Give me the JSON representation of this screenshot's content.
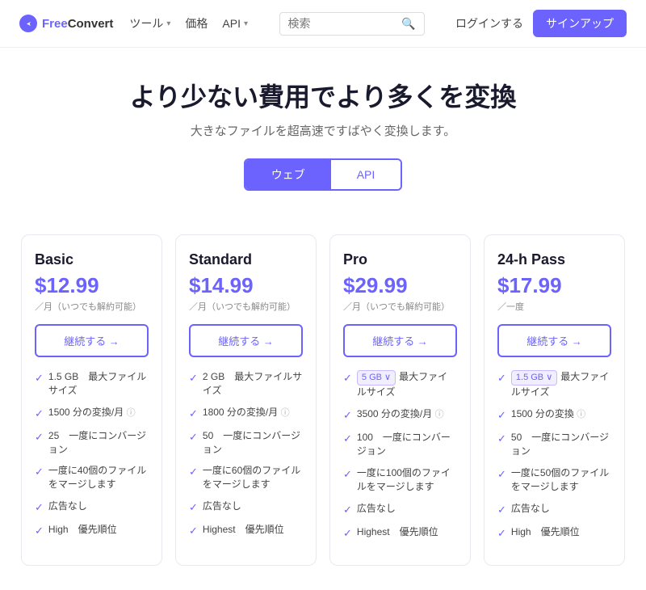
{
  "header": {
    "logo_free": "Free",
    "logo_convert": "Convert",
    "nav": [
      {
        "label": "ツール",
        "has_arrow": true
      },
      {
        "label": "価格",
        "has_arrow": false
      },
      {
        "label": "API",
        "has_arrow": true
      }
    ],
    "search_placeholder": "検索",
    "login_label": "ログインする",
    "signup_label": "サインアップ"
  },
  "hero": {
    "title": "より少ない費用でより多くを変換",
    "subtitle": "大きなファイルを超高速ですばやく変換します。",
    "tab_web": "ウェブ",
    "tab_api": "API"
  },
  "plans": [
    {
      "name": "Basic",
      "price": "$12.99",
      "period": "／月（いつでも解約可能）",
      "cta": "継続する →",
      "features": [
        {
          "text": "1.5 GB　最大ファイルサイズ",
          "badge": null,
          "info": false
        },
        {
          "text": "1500 分の変換/月",
          "badge": null,
          "info": true
        },
        {
          "text": "25　一度にコンバージョン",
          "badge": null,
          "info": false
        },
        {
          "text": "一度に40個のファイルをマージします",
          "badge": null,
          "info": false
        },
        {
          "text": "広告なし",
          "badge": null,
          "info": false
        },
        {
          "text": "High　優先順位",
          "badge": null,
          "info": false
        }
      ]
    },
    {
      "name": "Standard",
      "price": "$14.99",
      "period": "／月（いつでも解約可能）",
      "cta": "継続する →",
      "features": [
        {
          "text": "2 GB　最大ファイルサイズ",
          "badge": null,
          "info": false
        },
        {
          "text": "1800 分の変換/月",
          "badge": null,
          "info": true
        },
        {
          "text": "50　一度にコンバージョン",
          "badge": null,
          "info": false
        },
        {
          "text": "一度に60個のファイルをマージします",
          "badge": null,
          "info": false
        },
        {
          "text": "広告なし",
          "badge": null,
          "info": false
        },
        {
          "text": "Highest　優先順位",
          "badge": null,
          "info": false
        }
      ]
    },
    {
      "name": "Pro",
      "price": "$29.99",
      "period": "／月（いつでも解約可能）",
      "cta": "継続する →",
      "features": [
        {
          "text": "最大ファイルサイズ",
          "badge": "5 GB ∨",
          "info": false
        },
        {
          "text": "3500 分の変換/月",
          "badge": null,
          "info": true
        },
        {
          "text": "100　一度にコンバージョン",
          "badge": null,
          "info": false
        },
        {
          "text": "一度に100個のファイルをマージします",
          "badge": null,
          "info": false
        },
        {
          "text": "広告なし",
          "badge": null,
          "info": false
        },
        {
          "text": "Highest　優先順位",
          "badge": null,
          "info": false
        }
      ]
    },
    {
      "name": "24-h Pass",
      "price": "$17.99",
      "period": "／一度",
      "cta": "継続する →",
      "features": [
        {
          "text": "最大ファイルサイズ",
          "badge": "1.5 GB ∨",
          "info": false
        },
        {
          "text": "1500 分の変換",
          "badge": null,
          "info": true
        },
        {
          "text": "50　一度にコンバージョン",
          "badge": null,
          "info": false
        },
        {
          "text": "一度に50個のファイルをマージします",
          "badge": null,
          "info": false
        },
        {
          "text": "広告なし",
          "badge": null,
          "info": false
        },
        {
          "text": "High　優先順位",
          "badge": null,
          "info": false
        }
      ]
    }
  ]
}
